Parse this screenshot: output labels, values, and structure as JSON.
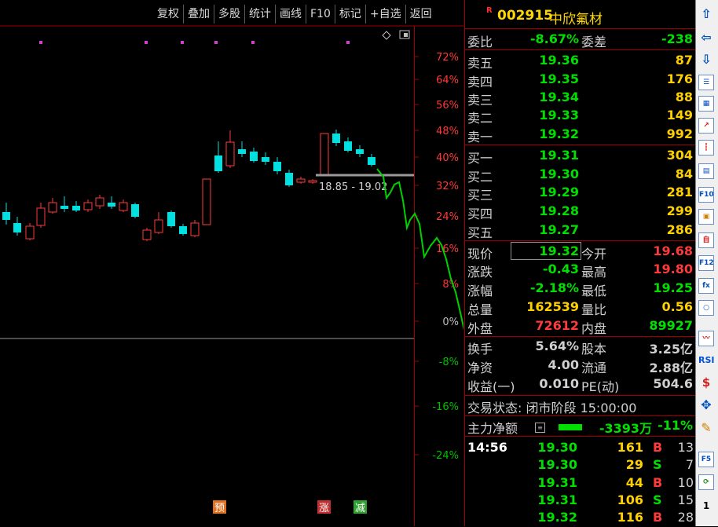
{
  "toolbar": {
    "buttons": [
      "复权",
      "叠加",
      "多股",
      "统计",
      "画线",
      "F10",
      "标记",
      "+自选",
      "返回"
    ]
  },
  "chart": {
    "y_axis_labels": [
      "72%",
      "64%",
      "56%",
      "48%",
      "40%",
      "32%",
      "24%",
      "16%",
      "8%",
      "0%",
      "-8%",
      "-16%",
      "-24%"
    ],
    "range_annotation": "18.85 - 19.02",
    "event_markers": [
      {
        "label": "预",
        "color": "#e07020"
      },
      {
        "label": "涨",
        "color": "#c03030"
      },
      {
        "label": "减",
        "color": "#30a030"
      }
    ]
  },
  "quote": {
    "flag": "R",
    "code": "002915",
    "name": "中欣氟材",
    "weibi": {
      "label": "委比",
      "value": "-8.67%",
      "label2": "委差",
      "value2": "-238"
    },
    "asks": [
      {
        "label": "卖五",
        "price": "19.36",
        "vol": "87"
      },
      {
        "label": "卖四",
        "price": "19.35",
        "vol": "176"
      },
      {
        "label": "卖三",
        "price": "19.34",
        "vol": "88"
      },
      {
        "label": "卖二",
        "price": "19.33",
        "vol": "149"
      },
      {
        "label": "卖一",
        "price": "19.32",
        "vol": "992"
      }
    ],
    "bids": [
      {
        "label": "买一",
        "price": "19.31",
        "vol": "304"
      },
      {
        "label": "买二",
        "price": "19.30",
        "vol": "84"
      },
      {
        "label": "买三",
        "price": "19.29",
        "vol": "281"
      },
      {
        "label": "买四",
        "price": "19.28",
        "vol": "299"
      },
      {
        "label": "买五",
        "price": "19.27",
        "vol": "286"
      }
    ],
    "stats": [
      {
        "l1": "现价",
        "v1": "19.32",
        "c1": "green",
        "l2": "今开",
        "v2": "19.68",
        "c2": "red"
      },
      {
        "l1": "涨跌",
        "v1": "-0.43",
        "c1": "green",
        "l2": "最高",
        "v2": "19.80",
        "c2": "red"
      },
      {
        "l1": "涨幅",
        "v1": "-2.18%",
        "c1": "green",
        "l2": "最低",
        "v2": "19.25",
        "c2": "green"
      },
      {
        "l1": "总量",
        "v1": "162539",
        "c1": "yellow",
        "l2": "量比",
        "v2": "0.56",
        "c2": "yellow"
      },
      {
        "l1": "外盘",
        "v1": "72612",
        "c1": "red",
        "l2": "内盘",
        "v2": "89927",
        "c2": "green"
      }
    ],
    "fundamentals": [
      {
        "l1": "换手",
        "v1": "5.64%",
        "l2": "股本",
        "v2": "3.25亿"
      },
      {
        "l1": "净资",
        "v1": "4.00",
        "l2": "流通",
        "v2": "2.88亿"
      },
      {
        "l1": "收益(一)",
        "v1": "0.010",
        "l2": "PE(动)",
        "v2": "504.6"
      }
    ],
    "status": "交易状态: 闭市阶段 15:00:00",
    "main_force": {
      "label": "主力净额",
      "amount": "-3393万",
      "pct": "-11%"
    },
    "ticks": [
      {
        "time": "14:56",
        "price": "19.30",
        "vol": "161",
        "side": "B",
        "count": "13"
      },
      {
        "time": "",
        "price": "19.30",
        "vol": "29",
        "side": "S",
        "count": "7"
      },
      {
        "time": "",
        "price": "19.31",
        "vol": "44",
        "side": "B",
        "count": "10"
      },
      {
        "time": "",
        "price": "19.31",
        "vol": "106",
        "side": "S",
        "count": "15"
      },
      {
        "time": "",
        "price": "19.32",
        "vol": "116",
        "side": "B",
        "count": "28"
      }
    ]
  },
  "right_toolbar": {
    "items": [
      "up-arrow",
      "left-arrow",
      "down-arrow",
      "list",
      "grid",
      "line-chart",
      "candle-chart",
      "table",
      "F10",
      "notes",
      "自",
      "F12",
      "fx",
      "circle",
      "wave",
      "RSI",
      "dollar",
      "move",
      "pencil",
      "F5",
      "refresh",
      "1"
    ]
  },
  "colors": {
    "up": "#ff3a3a",
    "down": "#00e0e0",
    "grid": "#a00000",
    "price_line": "#00d000"
  }
}
